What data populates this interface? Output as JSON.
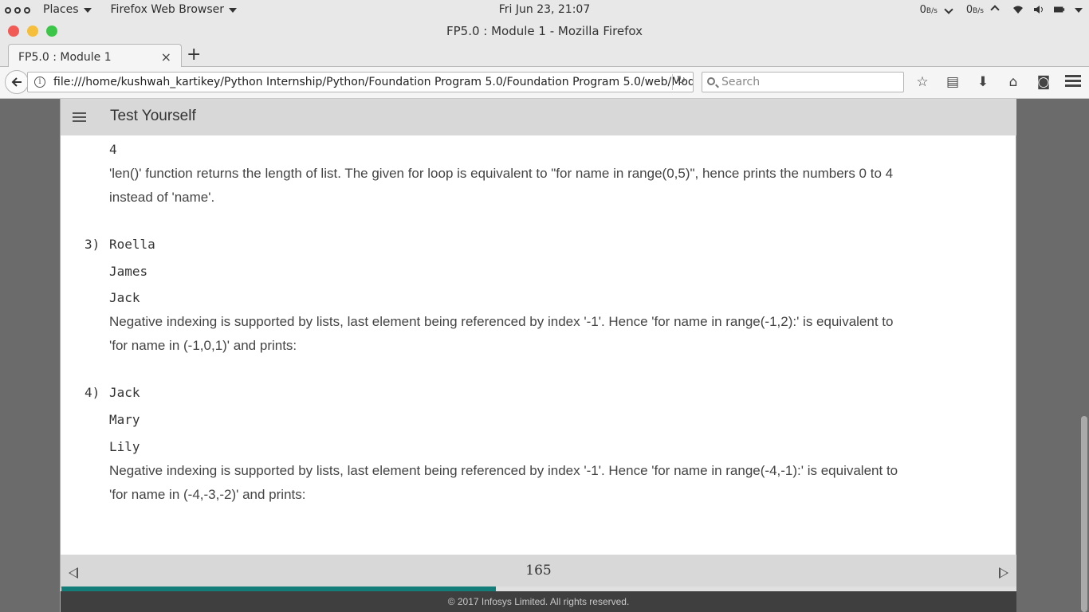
{
  "topbar": {
    "activities_label": "",
    "places_label": "Places",
    "app_menu_label": "Firefox Web Browser",
    "clock": "Fri Jun 23, 21:07",
    "net_down_value": "0",
    "net_down_unit": "B/s",
    "net_up_value": "0",
    "net_up_unit": "B/s"
  },
  "window": {
    "title": "FP5.0 : Module 1 - Mozilla Firefox"
  },
  "tabs": [
    {
      "label": "FP5.0 : Module 1"
    }
  ],
  "navbar": {
    "url": "file:///home/kushwah_kartikey/Python Internship/Python/Foundation Program 5.0/Foundation Program 5.0/web/Mod",
    "search_placeholder": "Search"
  },
  "page": {
    "header_title": "Test Yourself",
    "answers": {
      "a2_tail_code": "4",
      "a2_explanation": "'len()' function returns the length of list. The given for loop is equivalent to \"for name in range(0,5)\", hence prints the numbers 0 to 4 instead of 'name'.",
      "a3_number": "3)",
      "a3_lines": [
        "Roella",
        "James",
        "Jack"
      ],
      "a3_explanation": "Negative indexing is supported by lists, last element being referenced by index '-1'. Hence 'for name in range(-1,2):' is equivalent to 'for name in (-1,0,1)' and prints:",
      "a4_number": "4)",
      "a4_lines": [
        "Jack",
        "Mary",
        "Lily"
      ],
      "a4_explanation": "Negative indexing is supported by lists, last element being referenced by index '-1'. Hence 'for name in range(-4,-1):' is equivalent to 'for name in (-4,-3,-2)' and prints:"
    },
    "page_number": "165",
    "progress_percent": 45.5,
    "copyright": "© 2017 Infosys Limited. All rights reserved."
  },
  "colors": {
    "progress": "#137d7a",
    "header_bg": "#d8d8d8",
    "footer_bg": "#3f3f3f"
  }
}
